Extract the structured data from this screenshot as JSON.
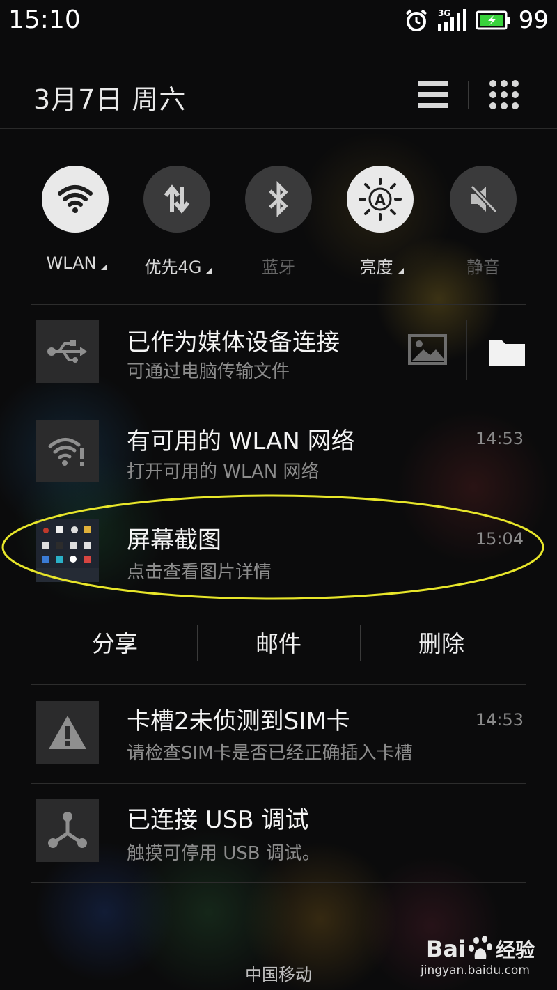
{
  "status_bar": {
    "time": "15:10",
    "network": "3G",
    "battery": "99",
    "icons": [
      "alarm-icon",
      "signal-icon",
      "battery-icon"
    ]
  },
  "header": {
    "date": "3月7日  周六",
    "icons": [
      "list-icon",
      "app-grid-icon"
    ]
  },
  "toggles": [
    {
      "label": "WLAN",
      "state": "on",
      "icon": "wifi-icon",
      "has_menu": true
    },
    {
      "label": "优先4G",
      "state": "off",
      "icon": "data-transfer-icon",
      "has_menu": true
    },
    {
      "label": "蓝牙",
      "state": "disabled",
      "icon": "bluetooth-icon",
      "has_menu": false
    },
    {
      "label": "亮度",
      "state": "on",
      "icon": "brightness-auto-icon",
      "has_menu": true
    },
    {
      "label": "静音",
      "state": "disabled",
      "icon": "mute-icon",
      "has_menu": false
    }
  ],
  "notifications": [
    {
      "title": "已作为媒体设备连接",
      "subtitle": "可通过电脑传输文件",
      "time": "",
      "icon": "usb-icon",
      "actions": [
        "image-icon",
        "folder-icon"
      ]
    },
    {
      "title": "有可用的 WLAN 网络",
      "subtitle": "打开可用的 WLAN 网络",
      "time": "14:53",
      "icon": "wifi-alert-icon"
    },
    {
      "title": "屏幕截图",
      "subtitle": "点击查看图片详情",
      "time": "15:04",
      "icon": "screenshot-thumbnail",
      "highlighted": true
    },
    {
      "title": "卡槽2未侦测到SIM卡",
      "subtitle": "请检查SIM卡是否已经正确插入卡槽",
      "time": "14:53",
      "icon": "warning-icon"
    },
    {
      "title": "已连接 USB 调试",
      "subtitle": "触摸可停用 USB 调试。",
      "time": "",
      "icon": "usb-debug-icon"
    }
  ],
  "screenshot_actions": [
    "分享",
    "邮件",
    "删除"
  ],
  "carrier": "中国移动",
  "watermark": {
    "logo": "Bai 经验",
    "url": "jingyan.baidu.com"
  },
  "colors": {
    "highlight_ellipse": "#e8e62a",
    "toggle_on": "#e9e9e9",
    "toggle_off": "#3a3a3b"
  }
}
